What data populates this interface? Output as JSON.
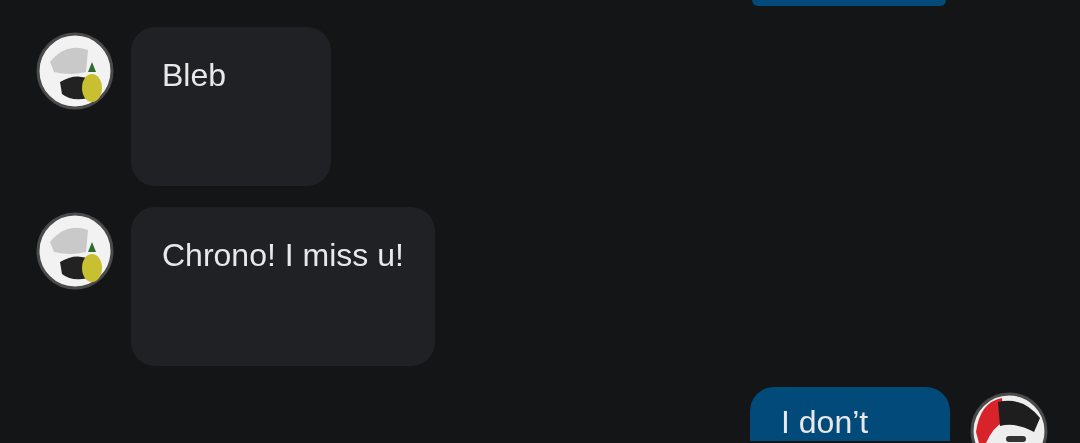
{
  "messages": [
    {
      "kind": "outgoing"
    },
    {
      "kind": "incoming",
      "text": "Bleb"
    },
    {
      "kind": "incoming",
      "text": "Chrono! I miss u!"
    },
    {
      "kind": "outgoing",
      "text": "I don’t"
    }
  ]
}
